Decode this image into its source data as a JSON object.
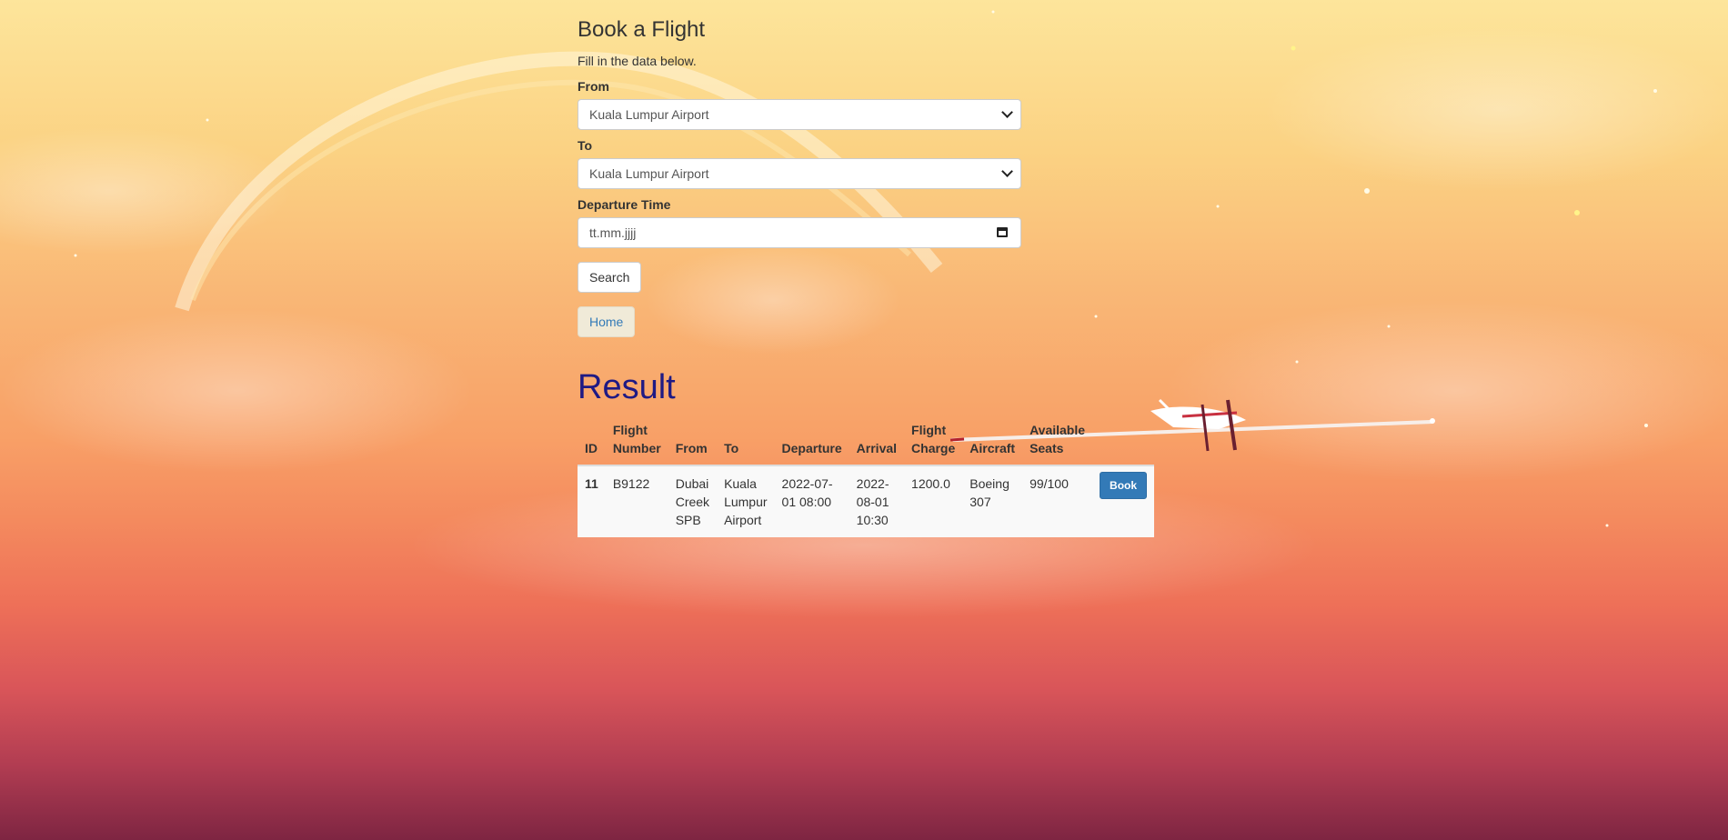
{
  "form": {
    "title": "Book a Flight",
    "subtitle": "Fill in the data below.",
    "from_label": "From",
    "from_value": "Kuala Lumpur Airport",
    "to_label": "To",
    "to_value": "Kuala Lumpur Airport",
    "departure_label": "Departure Time",
    "departure_value": "tt.mm.jjjj",
    "search_label": "Search",
    "home_label": "Home"
  },
  "result": {
    "heading": "Result",
    "columns": [
      "ID",
      "Flight Number",
      "From",
      "To",
      "Departure",
      "Arrival",
      "Flight Charge",
      "Aircraft",
      "Available Seats"
    ],
    "rows": [
      {
        "id": "11",
        "flight_number": "B9122",
        "from": "Dubai Creek SPB",
        "to": "Kuala Lumpur Airport",
        "departure": "2022-07-01 08:00",
        "arrival": "2022-08-01 10:30",
        "charge": "1200.0",
        "aircraft": "Boeing 307",
        "seats": "99/100",
        "action": "Book"
      }
    ]
  },
  "colors": {
    "result_heading": "#1f1a84",
    "book_button": "#337ab7",
    "link": "#337ab7"
  }
}
